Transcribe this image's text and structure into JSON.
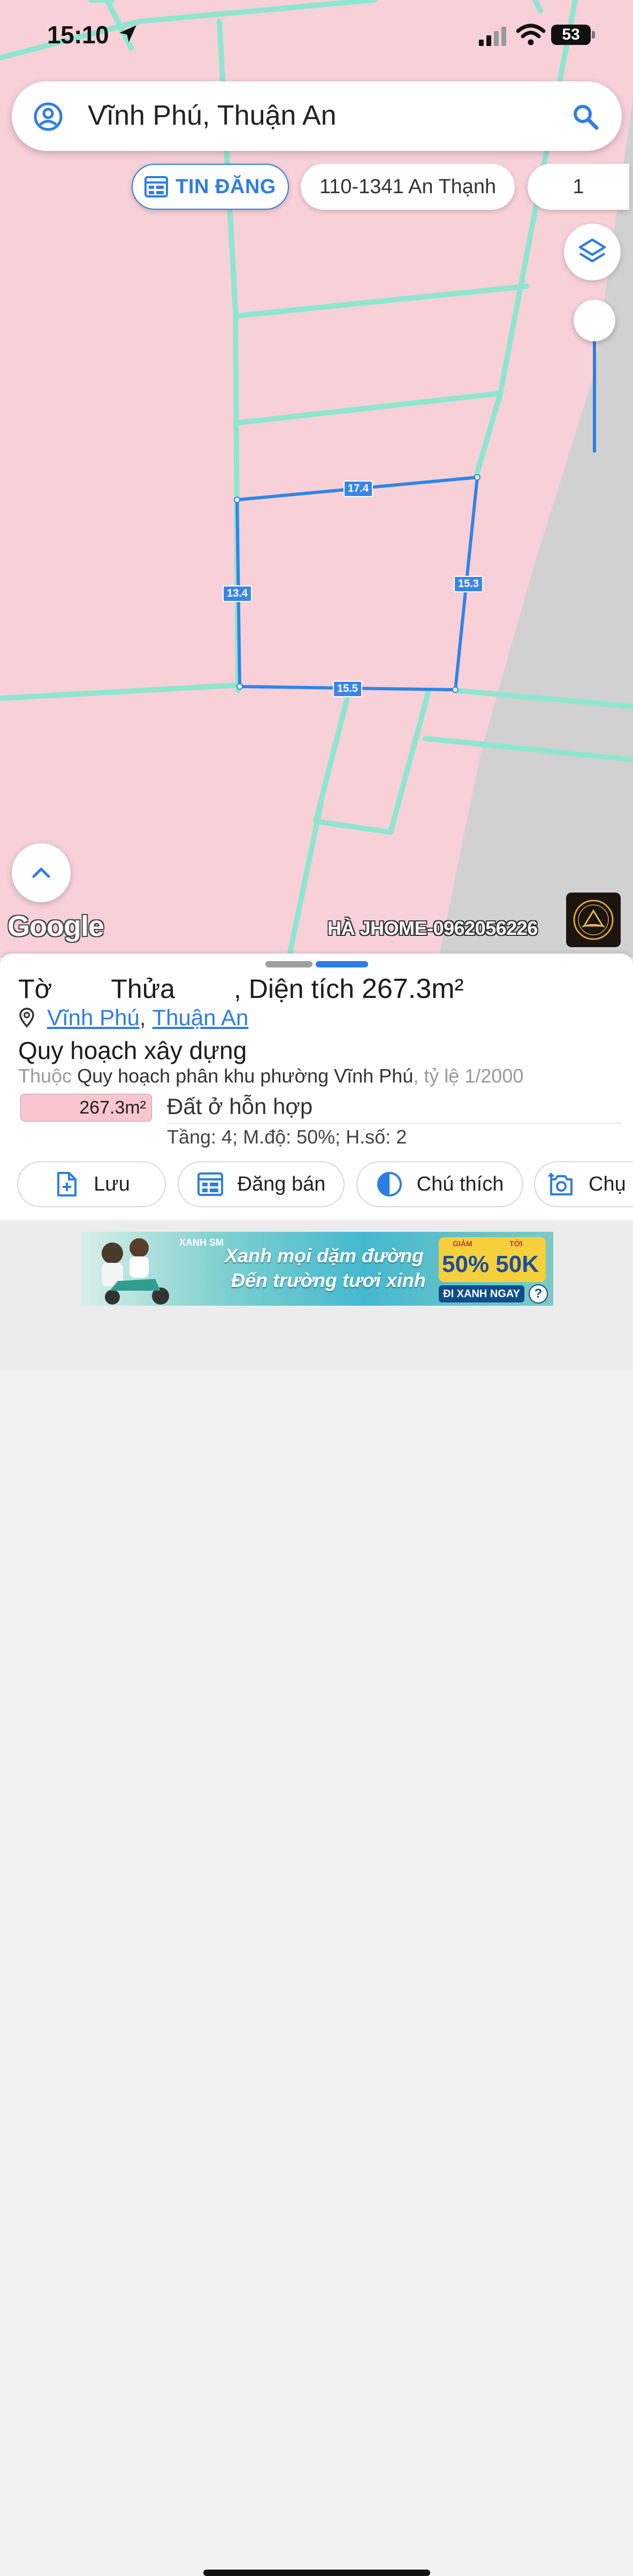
{
  "status_bar": {
    "time": "15:10",
    "battery": "53"
  },
  "search": {
    "query": "Vĩnh Phú, Thuận An"
  },
  "chips": {
    "listing": "TIN ĐĂNG",
    "address": "110-1341 An Thạnh",
    "count": "1"
  },
  "parcel": {
    "edges": {
      "top": "17.4",
      "right": "15.3",
      "bottom": "15.5",
      "left": "13.4"
    }
  },
  "map_labels": {
    "google": "Google",
    "watermark": "HÀ JHOME-0962056226"
  },
  "sheet": {
    "to_label": "Tờ",
    "thua_label": "Thửa",
    "area_prefix": ", Diện tích ",
    "area": "267.3m²",
    "ward": "Vĩnh Phú",
    "separator": ",",
    "district": "Thuận An",
    "plan_title": "Quy hoạch xây dựng",
    "plan_prefix": "Thuộc ",
    "plan_name": "Quy hoạch phân khu phường Vĩnh Phú",
    "plan_scale": ", tỷ lệ 1/2000",
    "zone_area": "267.3m²",
    "zone_type": "Đất ở hỗn hợp",
    "zone_details": "Tầng: 4; M.độ: 50%; H.số: 2"
  },
  "actions": {
    "save": "Lưu",
    "post": "Đăng bán",
    "legend": "Chú thích",
    "capture": "Chụ"
  },
  "ad": {
    "brand": "XANH SM",
    "line1": "Xanh mọi dặm đường",
    "line2": "Đến trường tươi xinh",
    "promo_pct": "50% 50K",
    "promo_small1": "GIẢM",
    "promo_small2": "TỚI",
    "cta": "ĐI XANH NGAY",
    "help": "?"
  },
  "colors": {
    "accent": "#2d7ee3",
    "map_pink": "#f8d0d8",
    "road": "#86e2cc"
  }
}
